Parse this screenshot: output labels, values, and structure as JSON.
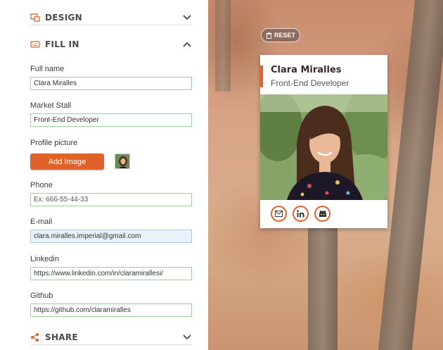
{
  "sections": {
    "design": {
      "label": "DESIGN"
    },
    "fill_in": {
      "label": "FILL IN"
    },
    "share": {
      "label": "SHARE"
    }
  },
  "form": {
    "full_name": {
      "label": "Full name",
      "value": "Clara Miralles"
    },
    "market_stall": {
      "label": "Market Stall",
      "value": "Front-End Developer"
    },
    "profile_picture": {
      "label": "Profile picture",
      "button": "Add Image"
    },
    "phone": {
      "label": "Phone",
      "value": "",
      "placeholder": "Ex: 666-55-44-33"
    },
    "email": {
      "label": "E-mail",
      "value": "clara.miralles.imperial@gmail.com"
    },
    "linkedin": {
      "label": "Linkedin",
      "value": "https://www.linkedin.com/in/claramirallesi/"
    },
    "github": {
      "label": "Github",
      "value": "https://github.com/claramiralles"
    }
  },
  "preview": {
    "reset_label": "RESET",
    "card": {
      "name": "Clara Miralles",
      "job": "Front-End Developer",
      "social_icons": [
        "mail-icon",
        "linkedin-icon",
        "github-icon"
      ]
    }
  },
  "colors": {
    "accent": "#e0622a",
    "field_border": "#9fd19f",
    "focused_bg": "#e9f1fb",
    "section_text": "#494949"
  }
}
